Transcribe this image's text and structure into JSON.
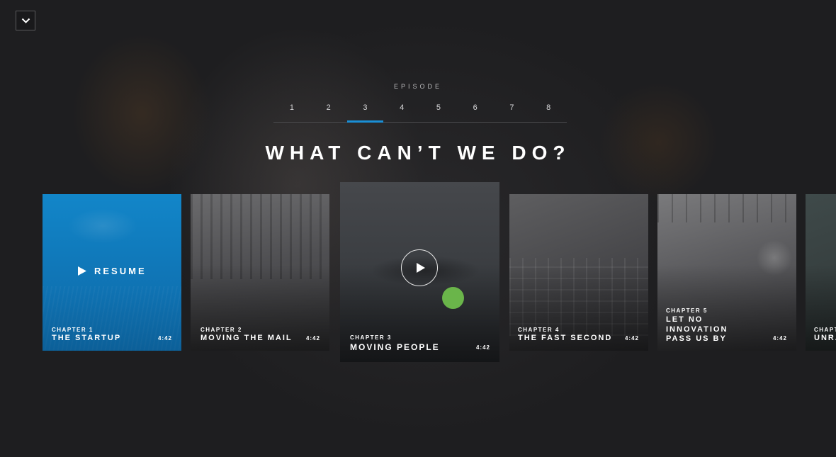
{
  "episode": {
    "label": "EPISODE",
    "tabs": [
      "1",
      "2",
      "3",
      "4",
      "5",
      "6",
      "7",
      "8"
    ],
    "active_index": 2
  },
  "title": "WHAT CAN’T WE DO?",
  "chapters": [
    {
      "number": "CHAPTER 1",
      "title": "THE STARTUP",
      "duration": "4:42",
      "action": "RESUME"
    },
    {
      "number": "CHAPTER 2",
      "title": "MOVING THE MAIL",
      "duration": "4:42"
    },
    {
      "number": "CHAPTER 3",
      "title": "MOVING PEOPLE",
      "duration": "4:42"
    },
    {
      "number": "CHAPTER 4",
      "title": "THE FAST SECOND",
      "duration": "4:42"
    },
    {
      "number": "CHAPTER 5",
      "title_lines": [
        "LET NO",
        "INNOVATION",
        "PASS US BY"
      ],
      "duration": "4:42"
    },
    {
      "number": "CHAPT",
      "title": "UNRA"
    }
  ],
  "colors": {
    "accent": "#1a8fd6",
    "card_highlight": "#1286c9",
    "cursor": "#6ab54a"
  },
  "icons": [
    "chevron-down-icon",
    "play-icon"
  ]
}
